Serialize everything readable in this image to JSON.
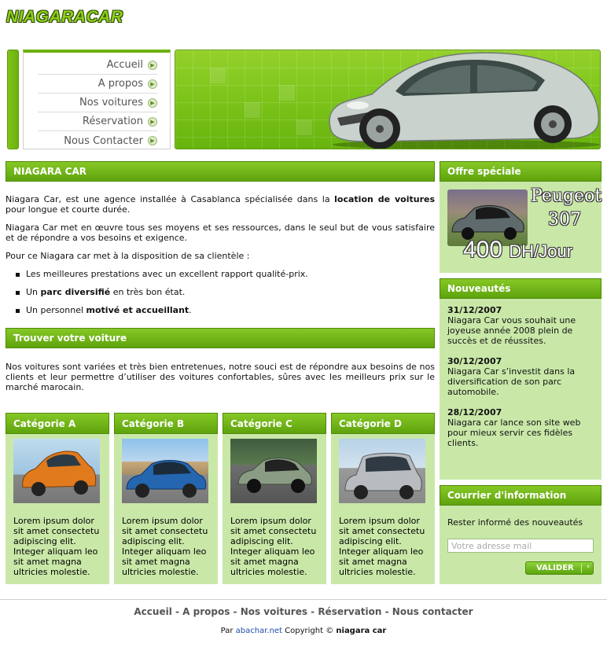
{
  "logo": "NIAGARACAR",
  "nav": [
    "Accueil",
    "A propos",
    "Nos voitures",
    "Réservation",
    "Nous Contacter"
  ],
  "main": {
    "title": "NIAGARA CAR",
    "intro_pre": "Niagara Car, est une agence installée à Casablanca spécialisée dans la ",
    "intro_bold": "location de voitures",
    "intro_post": " pour longue et courte durée.",
    "p2": "Niagara Car met en œuvre tous ses moyens et ses ressources, dans le seul but de vous satisfaire et de répondre a vos besoins et exigence.",
    "p3": "Pour ce Niagara car met à la disposition de sa clientèle :",
    "bullet1": "Les meilleures prestations avec un excellent rapport qualité-prix.",
    "bullet2_pre": "Un ",
    "bullet2_bold": "parc diversifié",
    "bullet2_post": " en très bon état.",
    "bullet3_pre": "Un personnel ",
    "bullet3_bold": "motivé et accueillant",
    "bullet3_post": ".",
    "find_title": "Trouver votre voiture",
    "find_text": "Nos voitures sont variées et très bien entretenues, notre souci est de répondre aux besoins de nos clients et leur permettre d’utiliser des voitures confortables, sûres avec les meilleurs prix sur le marché marocain."
  },
  "categories": [
    {
      "title": "Catégorie A",
      "text": "Lorem ipsum dolor sit amet consectetu adipiscing elit. Integer aliquam leo sit amet magna ultricies molestie.",
      "color": "#e07a1c"
    },
    {
      "title": "Catégorie B",
      "text": "Lorem ipsum dolor sit amet consectetu adipiscing elit. Integer aliquam leo sit amet magna ultricies molestie.",
      "color": "#2466b0"
    },
    {
      "title": "Catégorie C",
      "text": "Lorem ipsum dolor sit amet consectetu adipiscing elit. Integer aliquam leo sit amet magna ultricies molestie.",
      "color": "#8a9c84"
    },
    {
      "title": "Catégorie D",
      "text": "Lorem ipsum dolor sit amet consectetu adipiscing elit. Integer aliquam leo sit amet magna ultricies molestie.",
      "color": "#b8bcc0"
    }
  ],
  "offer": {
    "title": "Offre spéciale",
    "model": "Peugeot",
    "number": "307",
    "price": "400",
    "unit": "DH/Jour"
  },
  "news": {
    "title": "Nouveautés",
    "items": [
      {
        "date": "31/12/2007",
        "text": "Niagara Car vous souhait une joyeuse année 2008 plein de succès et de réussites."
      },
      {
        "date": "30/12/2007",
        "text": "Niagara Car s’investit dans la diversification de son parc automobile."
      },
      {
        "date": "28/12/2007",
        "text": "Niagara car lance son site web pour mieux servir ces fidèles clients."
      }
    ]
  },
  "newsletter": {
    "title": "Courrier d'information",
    "label": "Rester informé des nouveautés",
    "placeholder": "Votre adresse mail",
    "button": "VALIDER"
  },
  "footer": {
    "links": [
      "Accueil",
      "A propos",
      "Nos voitures",
      "Réservation",
      "Nous contacter"
    ],
    "sep": " - ",
    "by": "Par ",
    "author": "abachar.net",
    "copyright": " Copyright © ",
    "owner": "niagara car"
  },
  "colors": {
    "accent": "#6cb10f",
    "panel": "#c9e8a8"
  }
}
